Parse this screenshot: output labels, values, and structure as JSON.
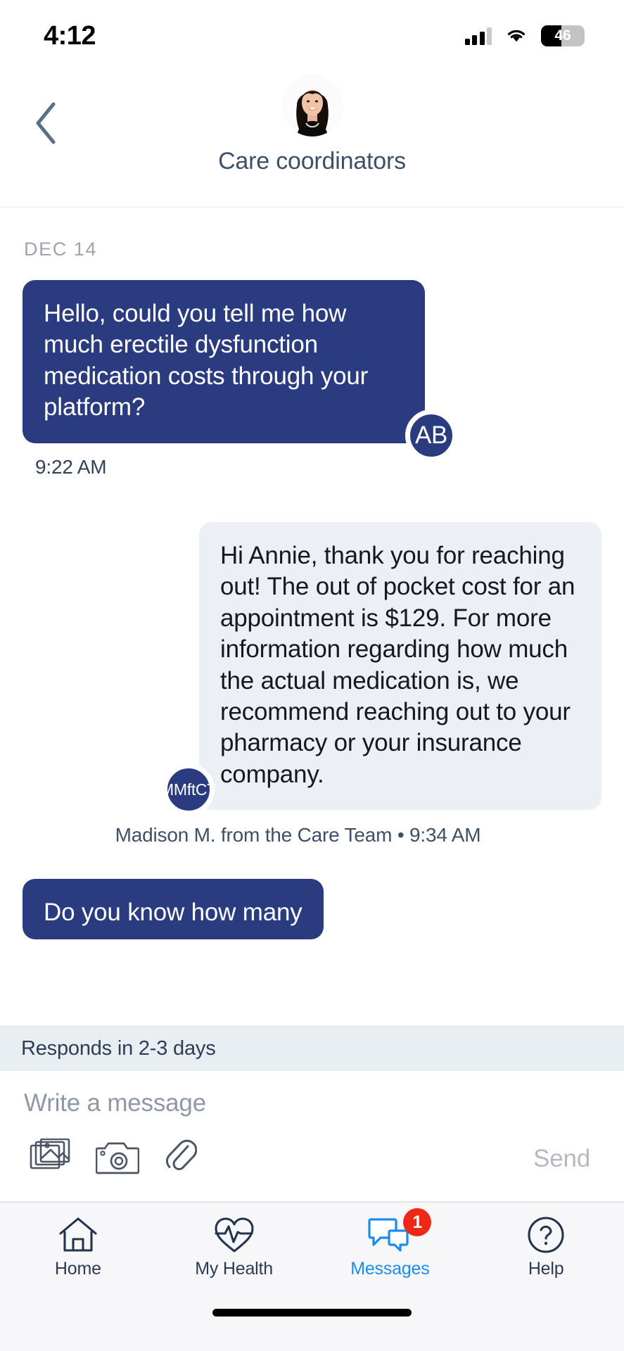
{
  "status_bar": {
    "time": "4:12",
    "battery_percent": "46",
    "battery_level": 46,
    "cellular_bars_filled": 3,
    "cellular_bars_total": 4,
    "wifi": "wifi-icon"
  },
  "header": {
    "back": "back-chevron-icon",
    "avatar": "care-coordinator-photo",
    "title": "Care coordinators"
  },
  "thread": {
    "date_separator": "DEC 14",
    "messages": [
      {
        "direction": "outgoing",
        "text": "Hello, could you tell me how much erectile dysfunction medication costs through your platform?",
        "avatar_initials": "AB",
        "timestamp": "9:22 AM"
      },
      {
        "direction": "incoming",
        "text": "Hi Annie, thank you for reaching out! The out of pocket cost for an appointment is $129. For more information regarding how much the actual medication is, we recommend reaching out to your pharmacy or your insurance company.",
        "avatar_initials": "MMftCT",
        "meta": "Madison M. from the Care Team • 9:34 AM"
      },
      {
        "direction": "outgoing",
        "text": "Do you know how many",
        "partial": true
      }
    ]
  },
  "composer": {
    "responds_banner": "Responds in 2-3 days",
    "placeholder": "Write a message",
    "value": "",
    "icons": [
      "photo-library-icon",
      "camera-icon",
      "paperclip-icon"
    ],
    "send_label": "Send"
  },
  "tabbar": {
    "items": [
      {
        "label": "Home",
        "icon": "home-icon",
        "active": false,
        "badge": ""
      },
      {
        "label": "My Health",
        "icon": "heartbeat-icon",
        "active": false,
        "badge": ""
      },
      {
        "label": "Messages",
        "icon": "chat-bubbles-icon",
        "active": true,
        "badge": "1"
      },
      {
        "label": "Help",
        "icon": "question-circle-icon",
        "active": false,
        "badge": ""
      }
    ]
  },
  "colors": {
    "brand_navy": "#2b3b80",
    "incoming_bubble": "#eceff3",
    "active_tab": "#1a8cf0",
    "badge_red": "#f02717",
    "header_text": "#3d5068"
  }
}
